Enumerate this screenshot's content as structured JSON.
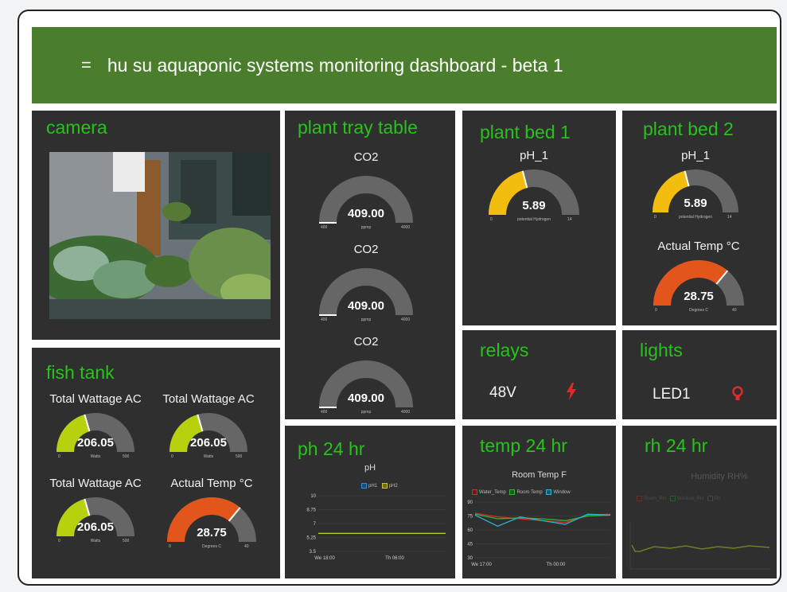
{
  "header": {
    "menu_icon": "=",
    "title": "hu su aquaponic systems monitoring dashboard  - beta 1"
  },
  "camera": {
    "title": "camera"
  },
  "fish_tank": {
    "title": "fish tank",
    "gauges": [
      {
        "label": "Total Wattage AC",
        "value": "206.05",
        "fraction": 0.41,
        "color": "#b8d10f",
        "min": "0",
        "max": "500",
        "unit": "Watts"
      },
      {
        "label": "Total Wattage AC",
        "value": "206.05",
        "fraction": 0.41,
        "color": "#b8d10f",
        "min": "0",
        "max": "500",
        "unit": "Watts"
      },
      {
        "label": "Total Wattage AC",
        "value": "206.05",
        "fraction": 0.41,
        "color": "#b8d10f",
        "min": "0",
        "max": "500",
        "unit": "Watts"
      },
      {
        "label": "Actual Temp °C",
        "value": "28.75",
        "fraction": 0.72,
        "color": "#e2561b",
        "min": "0",
        "max": "40",
        "unit": "Degrees C"
      }
    ]
  },
  "plant_tray": {
    "title": "plant tray table",
    "gauges": [
      {
        "label": "CO2",
        "value": "409.00",
        "fraction": 0.0,
        "color": "#999999",
        "min": "400",
        "max": "4000",
        "unit": "ppmp"
      },
      {
        "label": "CO2",
        "value": "409.00",
        "fraction": 0.0,
        "color": "#999999",
        "min": "400",
        "max": "4000",
        "unit": "ppmp"
      },
      {
        "label": "CO2",
        "value": "409.00",
        "fraction": 0.0,
        "color": "#999999",
        "min": "400",
        "max": "4000",
        "unit": "ppmp"
      }
    ]
  },
  "plant_bed_1": {
    "title": "plant bed 1",
    "gauge": {
      "label": "pH_1",
      "value": "5.89",
      "fraction": 0.42,
      "color": "#f3bd0f",
      "min": "0",
      "max": "14",
      "unit": "potential Hydrogen"
    }
  },
  "plant_bed_2": {
    "title": "plant bed 2",
    "gauges": [
      {
        "label": "pH_1",
        "value": "5.89",
        "fraction": 0.42,
        "color": "#f3bd0f",
        "min": "0",
        "max": "14",
        "unit": "potential Hydrogen"
      },
      {
        "label": "Actual Temp °C",
        "value": "28.75",
        "fraction": 0.72,
        "color": "#e2561b",
        "min": "0",
        "max": "40",
        "unit": "Degrees C"
      }
    ]
  },
  "relays": {
    "title": "relays",
    "item": "48V",
    "icon": "bolt-icon",
    "icon_color": "#e02a2a"
  },
  "lights": {
    "title": "lights",
    "item": "LED1",
    "icon": "bulb-icon",
    "icon_color": "#e02a2a"
  },
  "ph_24": {
    "title": "ph 24 hr",
    "chart_title": "pH",
    "legend": [
      "pH1",
      "pH2"
    ],
    "y_ticks": [
      "10",
      "8.75",
      "7",
      "5.25",
      "3.5"
    ],
    "x_ticks": [
      "We 18:00",
      "Th 06:00"
    ]
  },
  "temp_24": {
    "title": "temp 24 hr",
    "chart_title": "Room Temp F",
    "legend": [
      "Water_Temp",
      "Room Temp",
      "Window"
    ],
    "y_ticks": [
      "90",
      "75",
      "60",
      "45",
      "30"
    ],
    "x_ticks": [
      "We 17:00",
      "Th 00:00"
    ]
  },
  "rh_24": {
    "title": "rh 24 hr",
    "chart_title": "Humidity RH%",
    "legend": [
      "Room_RH",
      "Window_RH",
      "Rh"
    ]
  },
  "chart_data": [
    {
      "type": "line",
      "title": "pH",
      "xlabel": "",
      "ylabel": "",
      "x": [
        "We 18:00",
        "Th 06:00"
      ],
      "ylim": [
        3.5,
        10
      ],
      "series": [
        {
          "name": "pH1",
          "color": "#2f8fd6",
          "values": [
            5.6,
            5.6
          ]
        },
        {
          "name": "pH2",
          "color": "#c8c81a",
          "values": [
            5.6,
            5.6
          ]
        }
      ]
    },
    {
      "type": "line",
      "title": "Room Temp F",
      "xlabel": "",
      "ylabel": "",
      "x": [
        "We 17:00",
        "Th 00:00"
      ],
      "ylim": [
        30,
        90
      ],
      "series": [
        {
          "name": "Water_Temp",
          "color": "#d62b2b",
          "values": [
            78,
            74,
            72,
            70,
            68,
            76,
            77
          ]
        },
        {
          "name": "Room Temp",
          "color": "#2fb52f",
          "values": [
            77,
            72,
            73,
            72,
            70,
            75,
            76
          ]
        },
        {
          "name": "Window",
          "color": "#2db3d6",
          "values": [
            76,
            64,
            74,
            70,
            66,
            77,
            76
          ]
        }
      ]
    },
    {
      "type": "line",
      "title": "Humidity RH%",
      "xlabel": "",
      "ylabel": "",
      "series": [
        {
          "name": "Room_RH",
          "color": "#d62b2b",
          "values": []
        },
        {
          "name": "Window_RH",
          "color": "#2fb52f",
          "values": []
        },
        {
          "name": "Rh",
          "color": "#2fb52f",
          "values": []
        }
      ]
    }
  ]
}
